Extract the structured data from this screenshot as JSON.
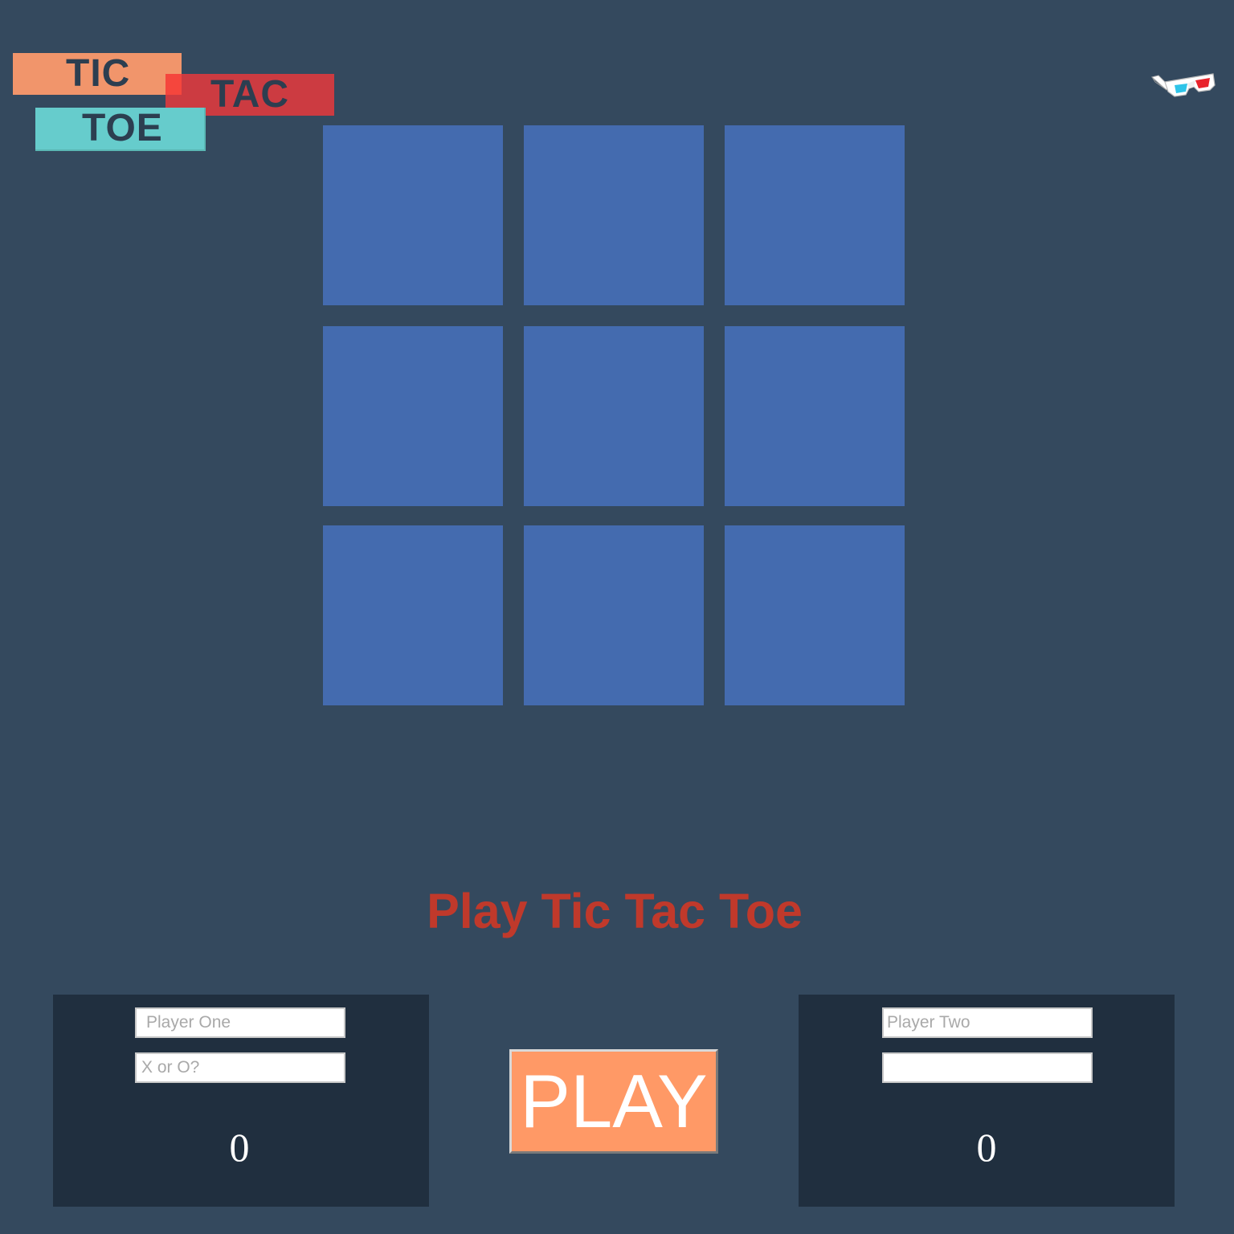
{
  "logo": {
    "word1": "TIC",
    "word2": "TAC",
    "word3": "TOE"
  },
  "icons": {
    "theme_toggle": "3d-glasses-icon"
  },
  "board": {
    "cells": [
      "",
      "",
      "",
      "",
      "",
      "",
      "",
      "",
      ""
    ]
  },
  "heading": "Play Tic Tac Toe",
  "player_one": {
    "name_value": "",
    "name_placeholder": "Player One",
    "mark_value": "",
    "mark_placeholder": "X or O?",
    "score": "0"
  },
  "player_two": {
    "name_value": "",
    "name_placeholder": "Player Two",
    "mark_value": "",
    "mark_placeholder": "",
    "score": "0"
  },
  "play_button": {
    "label": "PLAY"
  },
  "colors": {
    "background": "#34495e",
    "cell": "#446baf",
    "heading": "#c0392b",
    "panel": "#202f3f",
    "play_button": "#ff9966",
    "logo_tic": "#f1956b",
    "logo_tac": "#cc3b41",
    "logo_toe": "#66cccc"
  }
}
